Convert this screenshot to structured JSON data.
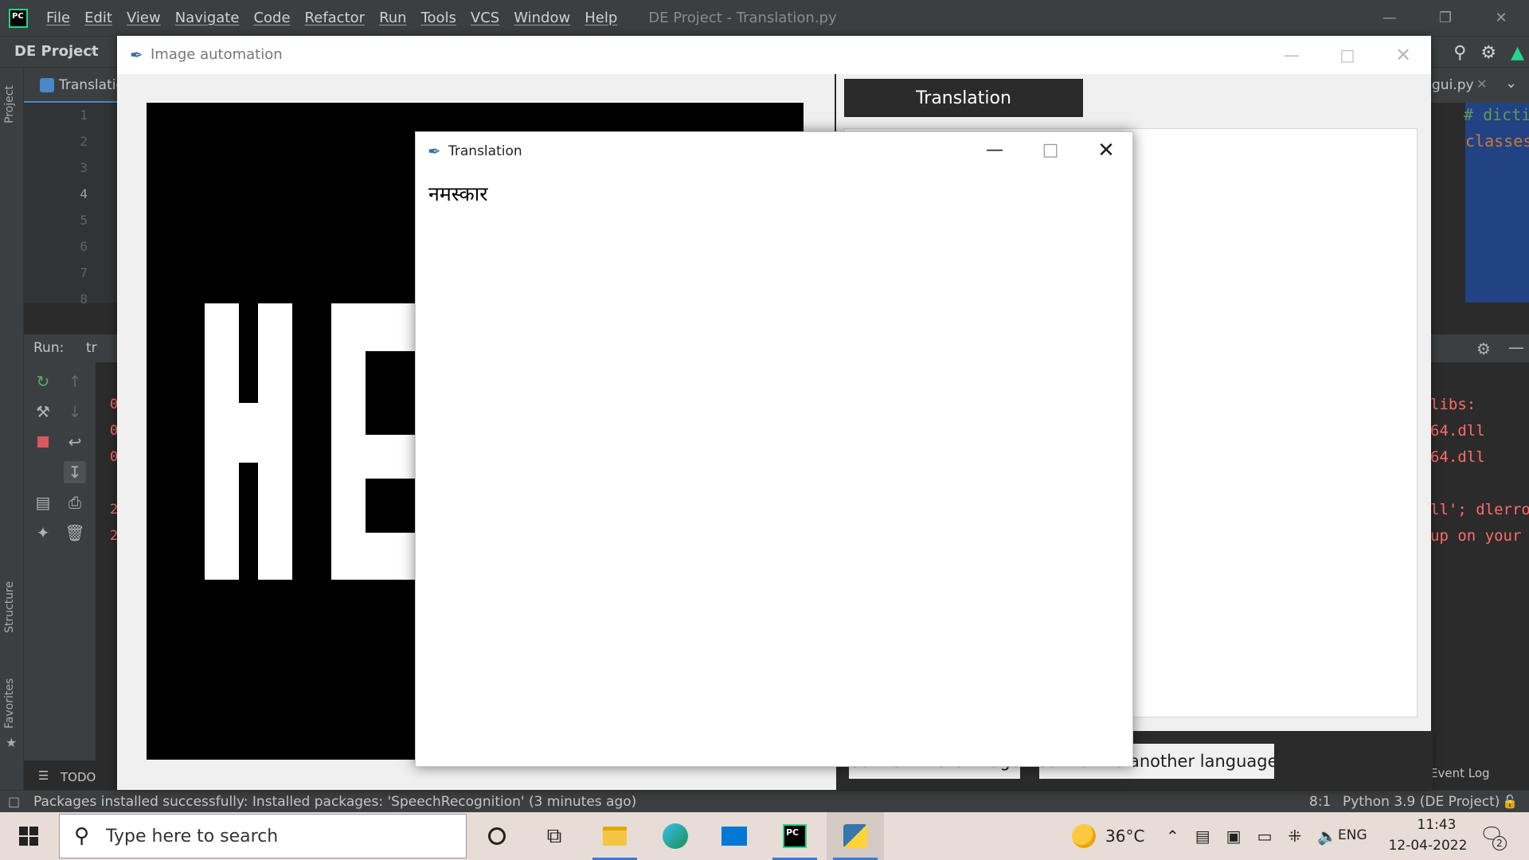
{
  "ide": {
    "logo": "PC",
    "menu": [
      "File",
      "Edit",
      "View",
      "Navigate",
      "Code",
      "Refactor",
      "Run",
      "Tools",
      "VCS",
      "Window",
      "Help"
    ],
    "title": "DE Project - Translation.py",
    "project_name": "DE Project",
    "editor_tab": "Translatic",
    "line_numbers": [
      "1",
      "2",
      "3",
      "4",
      "5",
      "6",
      "7",
      "8"
    ],
    "right_tab": "gui.py",
    "right_code": [
      "# dicti",
      "classes"
    ],
    "run_label": "Run:",
    "run_tab": "tr",
    "run_output_left": [
      "0",
      "0",
      "0",
      "2",
      "2"
    ],
    "run_output_right": [
      "libs:",
      "64.dll",
      "64.dll",
      "ll'; dlerro",
      "up on your"
    ],
    "side_labels": [
      "Project",
      "Structure",
      "Favorites"
    ],
    "todo": "TODO",
    "event_log": "Event Log",
    "status_message": "Packages installed successfully: Installed packages: 'SpeechRecognition' (3 minutes ago)",
    "cursor_pos": "8:1",
    "interpreter": "Python 3.9 (DE Project)"
  },
  "image_window": {
    "title": "Image automation",
    "translate_button": "Translation",
    "convert_more_button": "Convert more image",
    "convert_language_button": "Convert to another language"
  },
  "translation_window": {
    "title": "Translation",
    "text": "नमस्कार"
  },
  "taskbar": {
    "search_placeholder": "Type here to search",
    "weather": "36°C",
    "language": "ENG",
    "time": "11:43",
    "date": "12-04-2022",
    "notification_count": "2",
    "apps": [
      "cortana",
      "task-view",
      "file-explorer",
      "edge",
      "mail",
      "pycharm",
      "python"
    ]
  },
  "colors": {
    "ide_bg": "#2b2b2b",
    "ide_chrome": "#3c3f41",
    "tk_bg": "#f0f0f0",
    "button_dark": "#2b2b2b",
    "error_red": "#ff6b68",
    "taskbar": "#e7dcd6"
  }
}
